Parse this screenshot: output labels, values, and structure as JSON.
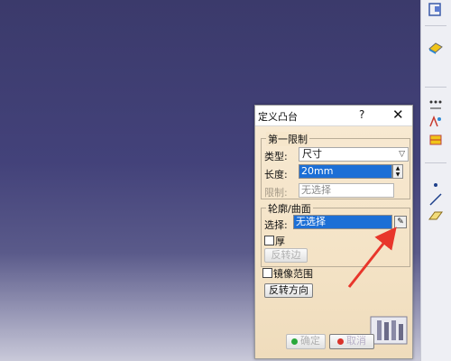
{
  "dialog": {
    "title": "定义凸台",
    "help_label": "?",
    "close_label": "✕",
    "first_limit": {
      "legend": "第一限制",
      "type_label": "类型:",
      "type_value": "尺寸",
      "length_label": "长度:",
      "length_value": "20mm",
      "limit_label": "限制:",
      "limit_value": "无选择"
    },
    "profile": {
      "legend": "轮廓/曲面",
      "select_label": "选择:",
      "select_value": "无选择",
      "thick_label": "厚",
      "reverse_side_label": "反转边"
    },
    "mirror_label": "镜像范围",
    "reverse_direction_label": "反转方向",
    "ok_label": "确定",
    "cancel_label": "取消"
  },
  "colors": {
    "annotation_arrow": "#e8362b",
    "selection": "#1c6fd6"
  },
  "toolbar": {
    "icons": [
      "sketch-box-icon",
      "surface-icon",
      "points-icon",
      "transform-icon",
      "point-icon",
      "line-icon",
      "plane-icon"
    ]
  }
}
